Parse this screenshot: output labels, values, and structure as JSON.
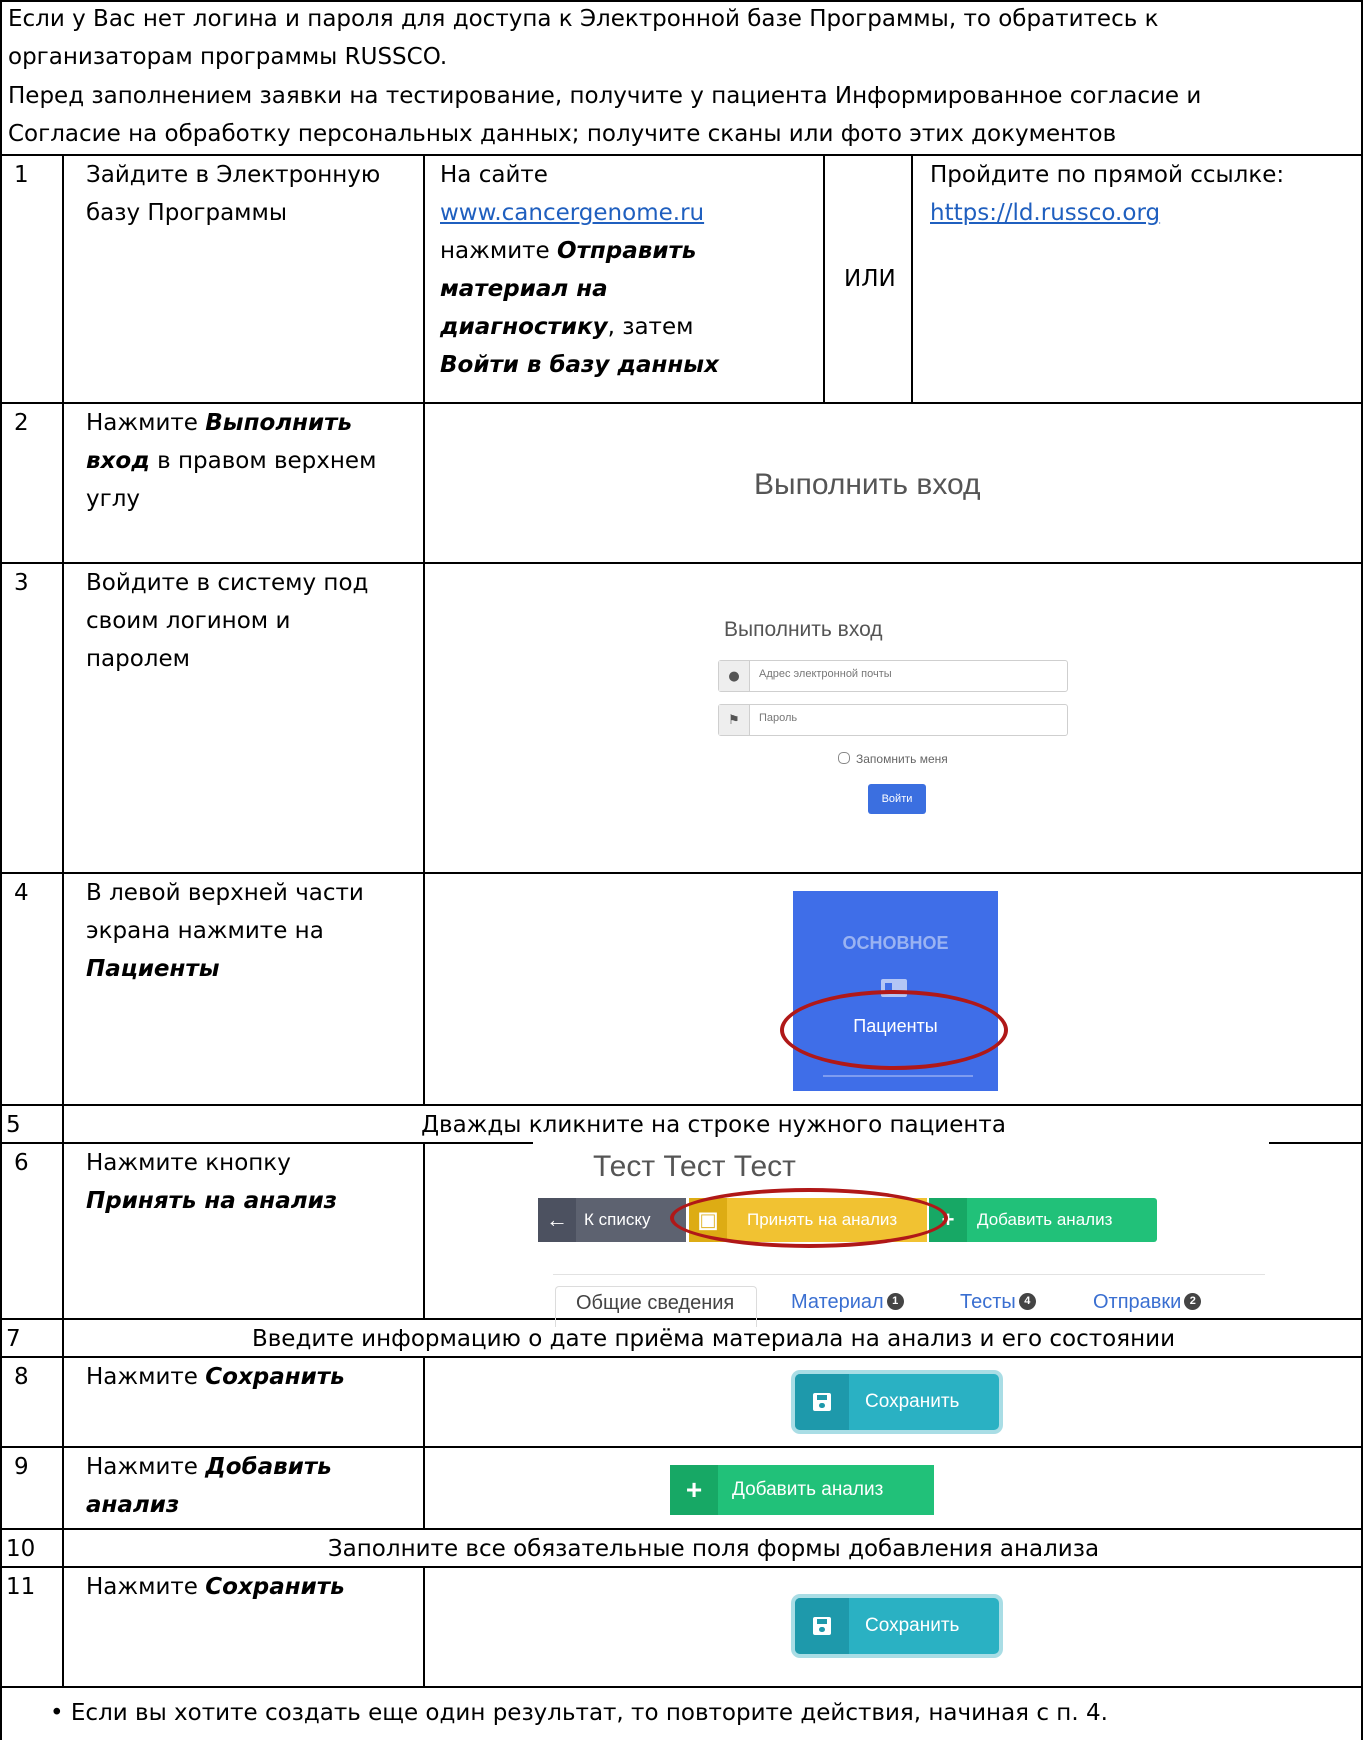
{
  "intro": {
    "line1": "Если у Вас нет логина и пароля для доступа к Электронной базе Программы, то обратитесь к",
    "line2": "организаторам программы RUSSCO.",
    "line3": "Перед заполнением заявки на тестирование, получите у пациента Информированное согласие и",
    "line4": "Согласие на обработку персональных данных; получите сканы или фото этих документов"
  },
  "rows": [
    {
      "num": "1",
      "text": [
        "Зайдите в Электронную",
        "базу Программы"
      ]
    },
    {
      "num": "2",
      "text_bold": "Выполнить",
      "text_bold2": "вход",
      "pre": "Нажмите ",
      "post": " в правом верхнем",
      "line3": "углу"
    },
    {
      "num": "3",
      "text": [
        "Войдите в систему под",
        "своим логином и",
        "паролем"
      ]
    },
    {
      "num": "4",
      "text": [
        "В левой верхней части",
        "экрана нажмите на"
      ],
      "bold": "Пациенты"
    },
    {
      "num": "5",
      "text": "Дважды кликните на строке нужного пациента"
    },
    {
      "num": "6",
      "text": "Нажмите кнопку",
      "bold": "Принять на анализ"
    },
    {
      "num": "7",
      "text": "Введите информацию о дате приёма материала на анализ и его состоянии"
    },
    {
      "num": "8",
      "pre": "Нажмите ",
      "bold": "Сохранить"
    },
    {
      "num": "9",
      "pre": "Нажмите ",
      "bold": "Добавить",
      "bold2": "анализ"
    },
    {
      "num": "10",
      "text": "Заполните все обязательные поля формы добавления анализа"
    },
    {
      "num": "11",
      "pre": "Нажмите ",
      "bold": "Сохранить"
    }
  ],
  "row1_option_a": {
    "line1": "На сайте",
    "link": "www.cancergenome.ru",
    "line3_pre": "нажмите ",
    "bold1": "Отправить",
    "bold2": "материал на",
    "bold3": "диагностику",
    "line5_post": ", затем",
    "bold4": "Войти в базу данных"
  },
  "row1_or": "ИЛИ",
  "row1_option_b": {
    "line1": "Пройдите по прямой ссылке:",
    "link": "https://ld.russco.org"
  },
  "screens": {
    "login_link": "Выполнить вход",
    "login_form": {
      "title": "Выполнить вход",
      "email_placeholder": "Адрес электронной почты",
      "password_placeholder": "Пароль",
      "remember": "Запомнить меня",
      "submit": "Войти"
    },
    "sidebar": {
      "section": "ОСНОВНОЕ",
      "item": "Пациенты"
    },
    "patient": {
      "name": "Тест Тест Тест",
      "back": "К списку",
      "accept": "Принять на анализ",
      "add": "Добавить анализ",
      "tabs": [
        {
          "label": "Общие сведения"
        },
        {
          "label": "Материал",
          "badge": "1"
        },
        {
          "label": "Тесты",
          "badge": "4"
        },
        {
          "label": "Отправки",
          "badge": "2"
        }
      ]
    },
    "save": "Сохранить",
    "add_analysis": "Добавить анализ"
  },
  "footer": "Если вы хотите создать еще один результат, то повторите действия, начиная с п. 4.",
  "colors": {
    "link": "#1f5fbf",
    "highlight": "#b01818",
    "accent_blue": "#3f6ee8",
    "yellow": "#f1c232",
    "green": "#21c179",
    "teal": "#2ab1c3"
  }
}
